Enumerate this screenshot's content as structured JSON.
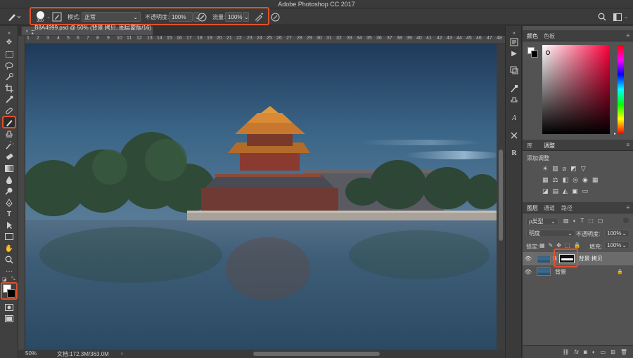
{
  "app": {
    "title": "Adobe Photoshop CC 2017"
  },
  "options_bar": {
    "brush_size": "300",
    "mode_label": "模式:",
    "mode_value": "正常",
    "opacity_label": "不透明度:",
    "opacity_value": "100%",
    "flow_label": "流量:",
    "flow_value": "100%"
  },
  "document": {
    "tab_title": "_B8A4999.psd @ 50% (背景 拷贝, 图层蒙版/16) *",
    "zoom": "50%",
    "doc_info": "文档:172.3M/363.0M",
    "ruler_ticks": [
      "50",
      "100",
      "150",
      "200",
      "250",
      "300",
      "350",
      "400",
      "450",
      "500",
      "550",
      "600",
      "650",
      "700",
      "750",
      "800",
      "850",
      "900",
      "950",
      "1000",
      "1050",
      "1100",
      "1150",
      "1200",
      "1250",
      "1300",
      "1350",
      "1400",
      "1450",
      "1500",
      "1550",
      "1600",
      "1650",
      "1700",
      "1750",
      "1800",
      "1850",
      "1900",
      "1950",
      "2000",
      "2050",
      "2100",
      "2150",
      "2200",
      "2250",
      "2300",
      "2350",
      "2400",
      "2450",
      "2500",
      "2550",
      "2600",
      "2650",
      "2700",
      "2750",
      "2800",
      "2850",
      "2900",
      "2950",
      "3000",
      "3050",
      "3100",
      "3150",
      "3200",
      "3250",
      "3300",
      "3350",
      "3400",
      "3450",
      "3500",
      "3550",
      "3600",
      "3650",
      "3700",
      "3750",
      "3800",
      "3850",
      "3900",
      "3950",
      "4000",
      "4050",
      "4100",
      "4150",
      "4200",
      "4250",
      "4300",
      "4350",
      "4400",
      "4450",
      "4500",
      "4550",
      "4600",
      "4650",
      "4700",
      "4750",
      "4800"
    ]
  },
  "color_panel": {
    "tab_color": "颜色",
    "tab_swatches": "色板"
  },
  "adjust_panel": {
    "tab_library": "库",
    "tab_adjust": "调整",
    "add_adjustment": "添加调整"
  },
  "layers_panel": {
    "tab_layers": "图层",
    "tab_channels": "通道",
    "tab_paths": "路径",
    "filter_type": "ρ类型",
    "blend_mode": "明度",
    "opacity_label": "不透明度:",
    "opacity_value": "100%",
    "lock_label": "锁定:",
    "fill_label": "填充:",
    "fill_value": "100%",
    "layers": [
      {
        "name": "背景 拷贝"
      },
      {
        "name": "背景"
      }
    ]
  },
  "colors": {
    "highlight": "#e2502a",
    "panel_bg": "#535353",
    "active_layer": "#6b6b6b"
  }
}
